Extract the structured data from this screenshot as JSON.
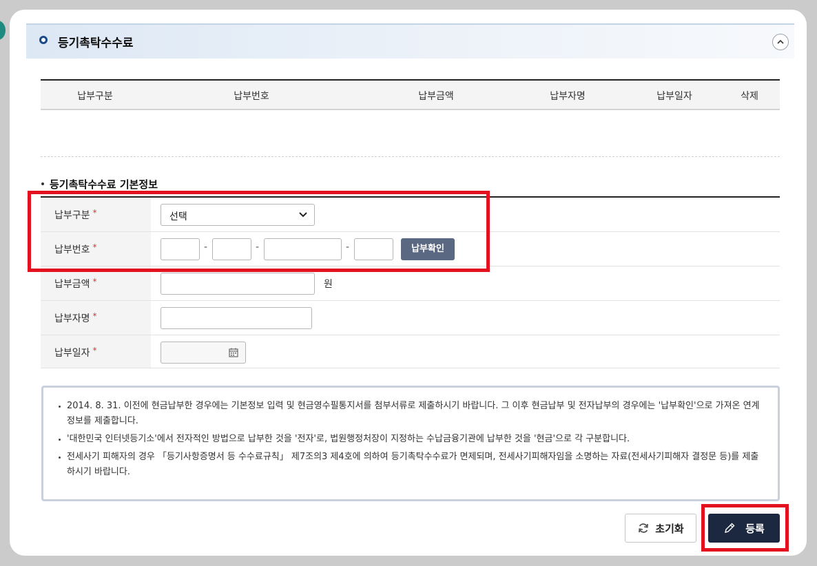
{
  "section": {
    "title": "등기촉탁수수료"
  },
  "list_table": {
    "columns": [
      "납부구분",
      "납부번호",
      "납부금액",
      "납부자명",
      "납부일자",
      "삭제"
    ]
  },
  "form": {
    "title": "등기촉탁수수료 기본정보",
    "required_mark": "*",
    "fields": {
      "payment_type": {
        "label": "납부구분",
        "value": "선택"
      },
      "payment_number": {
        "label": "납부번호",
        "separator": "-",
        "confirm_label": "납부확인"
      },
      "payment_amount": {
        "label": "납부금액",
        "unit": "원"
      },
      "payer_name": {
        "label": "납부자명"
      },
      "payment_date": {
        "label": "납부일자"
      }
    }
  },
  "notice": {
    "items": [
      "2014. 8. 31. 이전에 현금납부한 경우에는 기본정보 입력 및 현금영수필통지서를 첨부서류로 제출하시기 바랍니다. 그 이후 현금납부 및 전자납부의 경우에는 '납부확인'으로 가져온 연계정보를 제출합니다.",
      "'대한민국 인터넷등기소'에서 전자적인 방법으로 납부한 것을 '전자'로, 법원행정처장이 지정하는 수납금융기관에 납부한 것을 '현금'으로 각 구분합니다.",
      "전세사기 피해자의 경우 「등기사항증명서 등 수수료규칙」 제7조의3 제4호에 의하여 등기촉탁수수료가 면제되며, 전세사기피해자임을 소명하는 자료(전세사기피해자 결정문 등)를 제출하시기 바랍니다."
    ]
  },
  "buttons": {
    "reset": "초기화",
    "submit": "등록"
  },
  "colors": {
    "highlight": "#e3101f",
    "submit_bg": "#1c2840",
    "confirm_bg": "#5a6882",
    "required": "#d33"
  }
}
